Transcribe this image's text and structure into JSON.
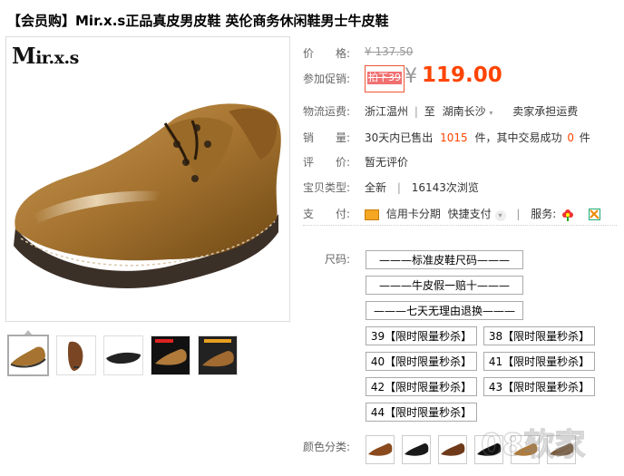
{
  "title": "【会员购】Mir.x.s正品真皮男皮鞋 英伦商务休闲鞋男士牛皮鞋",
  "gallery": {
    "brand_logo": "Mir.x.s",
    "active_thumb": 0,
    "thumbnail_count": 5
  },
  "price": {
    "label": "价　　格:",
    "original": "¥ 137.50"
  },
  "promo": {
    "label": "参加促销:",
    "badge": "拍下39",
    "currency": "¥",
    "price": "119.00"
  },
  "shipping": {
    "label": "物流运费:",
    "from": "浙江温州",
    "sep": "|",
    "to_prefix": "至",
    "to": "湖南长沙",
    "seller_pays": "卖家承担运费"
  },
  "sales": {
    "label": "销　　量:",
    "prefix": "30天内已售出",
    "count": "1015",
    "unit": "件，其中交易成功",
    "success": "0",
    "success_unit": "件"
  },
  "rating": {
    "label": "评　　价:",
    "value": "暂无评价"
  },
  "item_type": {
    "label": "宝贝类型:",
    "value": "全新",
    "sep": "|",
    "views": "16143次浏览"
  },
  "payment": {
    "label": "支　　付:",
    "credit": "信用卡分期",
    "quick": "快捷支付",
    "services_label": "服务:"
  },
  "size": {
    "label": "尺码:",
    "wide_options": [
      "———标准皮鞋尺码———",
      "———牛皮假一赔十———",
      "———七天无理由退换———"
    ],
    "options": [
      "39【限时限量秒杀】",
      "38【限时限量秒杀】",
      "40【限时限量秒杀】",
      "41【限时限量秒杀】",
      "42【限时限量秒杀】",
      "43【限时限量秒杀】",
      "44【限时限量秒杀】"
    ]
  },
  "colors": {
    "label": "颜色分类:",
    "swatch_count": 6,
    "selected": 0
  },
  "watermark": "08软家"
}
